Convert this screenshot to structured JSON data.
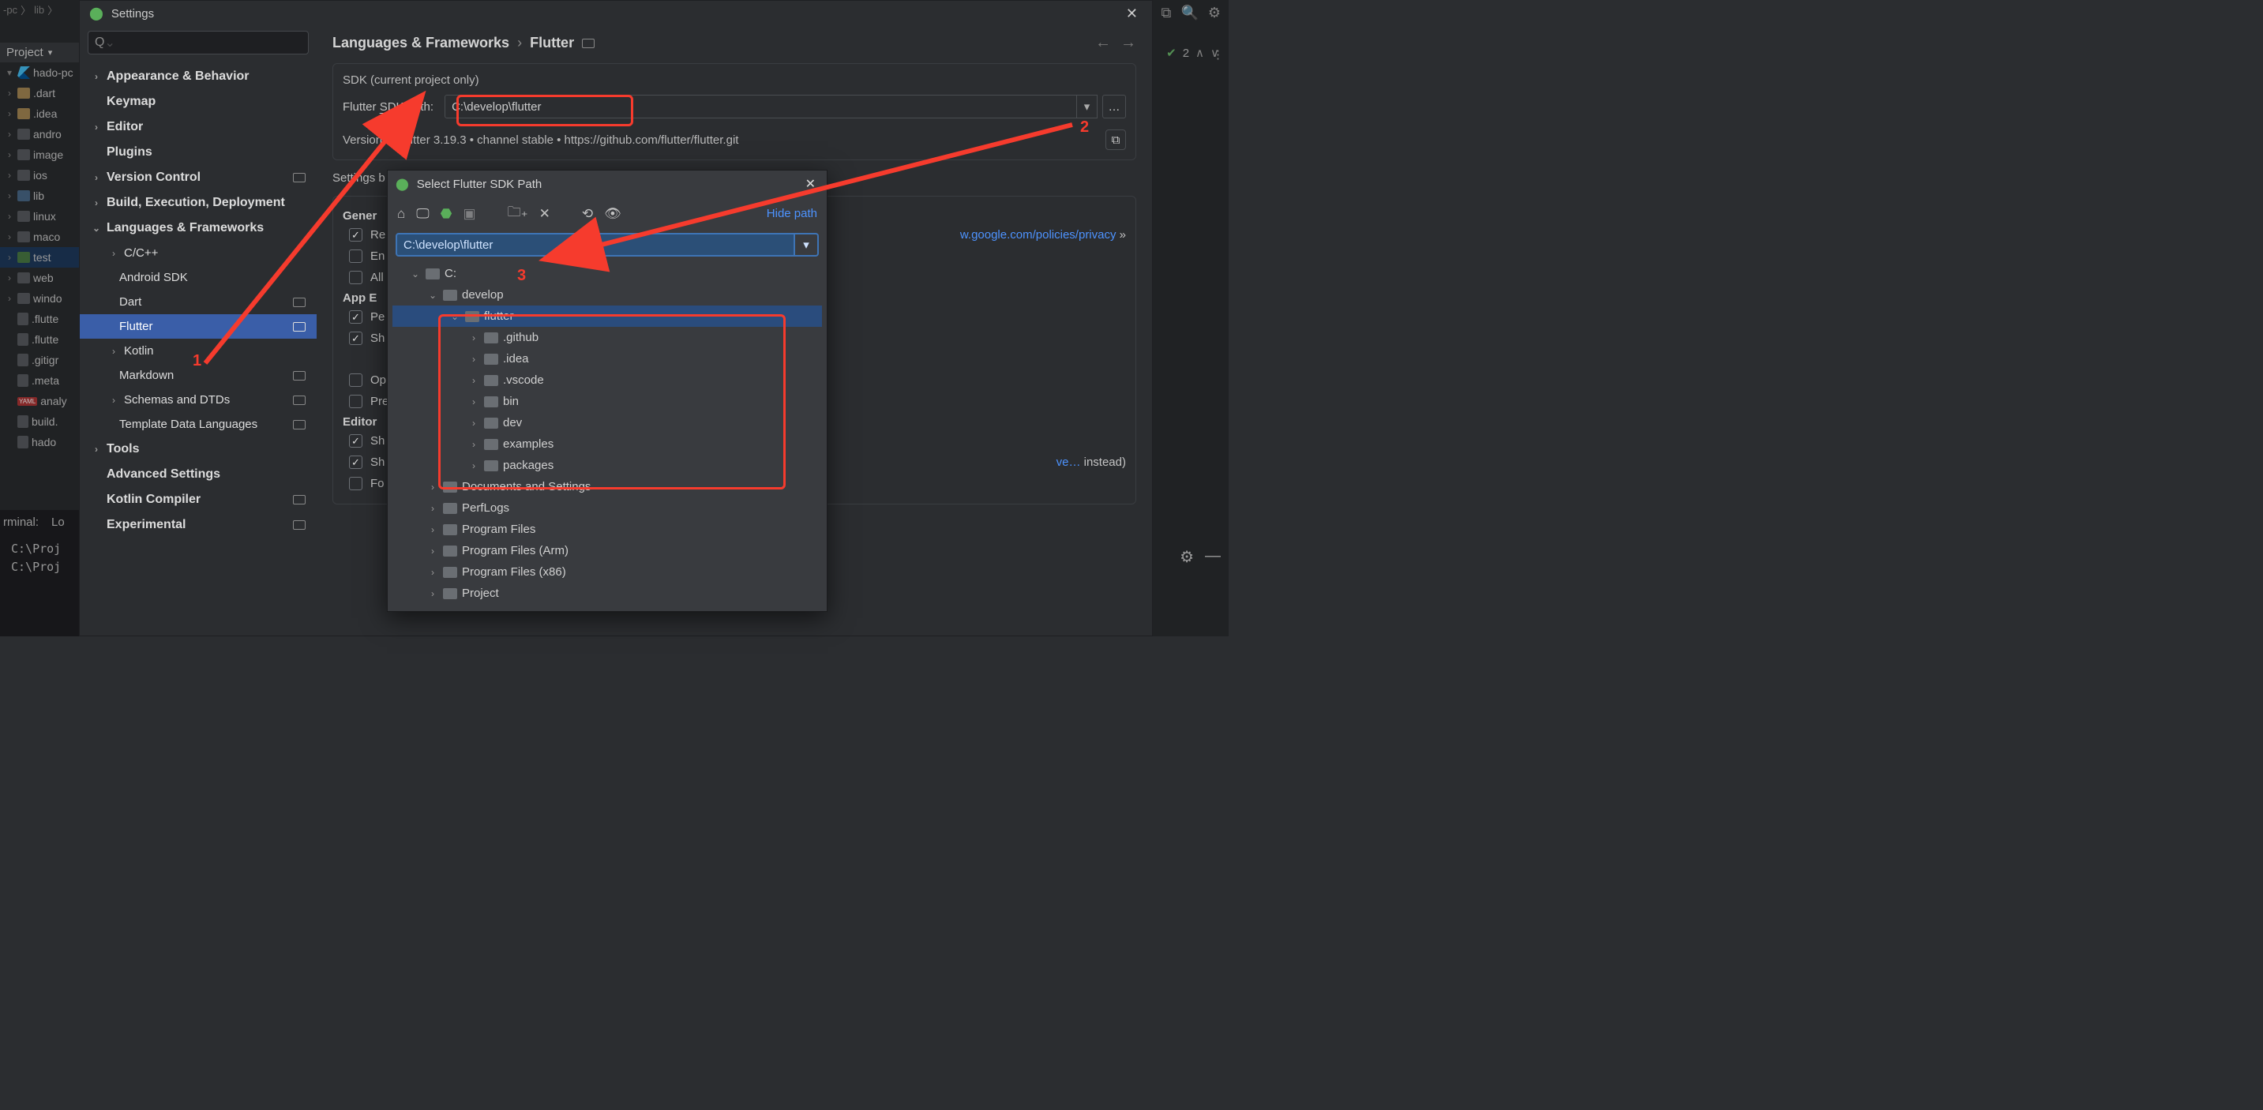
{
  "breadcrumb": {
    "a": "-pc",
    "b": "lib"
  },
  "project_header": "Project",
  "project_root": "hado-pc",
  "project_tree": [
    ".dart",
    ".idea",
    "andro",
    "image",
    "ios",
    "lib",
    "linux",
    "maco",
    "test",
    "web",
    "windo",
    ".flutte",
    ".flutte",
    ".gitigr",
    ".meta",
    "analy",
    "build.",
    "hado"
  ],
  "terminal_tab_a": "rminal:",
  "terminal_tab_b": "Lo",
  "terminal_lines": [
    "C:\\Proj",
    "C:\\Proj"
  ],
  "right": {
    "problems_count": "2"
  },
  "dialog": {
    "title": "Settings",
    "search_placeholder": "Q",
    "nav": {
      "appearance": "Appearance & Behavior",
      "keymap": "Keymap",
      "editor": "Editor",
      "plugins": "Plugins",
      "vcs": "Version Control",
      "bed": "Build, Execution, Deployment",
      "lang": "Languages & Frameworks",
      "cc": "C/C++",
      "android_sdk": "Android SDK",
      "dart": "Dart",
      "flutter": "Flutter",
      "kotlin": "Kotlin",
      "markdown": "Markdown",
      "schemas": "Schemas and DTDs",
      "template": "Template Data Languages",
      "tools": "Tools",
      "adv": "Advanced Settings",
      "kcomp": "Kotlin Compiler",
      "exp": "Experimental"
    },
    "crumb1": "Languages & Frameworks",
    "crumb2": "Flutter",
    "sdk_group": "SDK (current project only)",
    "sdk_label": "Flutter SDK path:",
    "sdk_value": "C:\\develop\\flutter",
    "version_label": "Version:",
    "version_value": "Flutter 3.19.3 • channel stable • https://github.com/flutter/flutter.git",
    "settings_block_prefix": "Settings b",
    "general": "Gener",
    "chk_re": "Re",
    "chk_en": "En",
    "chk_all": "All",
    "app_exec": "App E",
    "chk_pe": "Pe",
    "chk_sh1": "Sh",
    "chk_op": "Op",
    "chk_pre": "Pre",
    "editor_sect": "Editor",
    "chk_sh2": "Sh",
    "chk_sh3": "Sh",
    "chk_fo": "Fo",
    "policy_link": "w.google.com/policies/privacy",
    "policy_suffix": " »",
    "save_hint_a": "ve…",
    "save_hint_b": "   instead)"
  },
  "path_dialog": {
    "title": "Select Flutter SDK Path",
    "hide": "Hide path",
    "path_value": "C:\\develop\\flutter",
    "tree": {
      "c": "C:",
      "develop": "develop",
      "flutter": "flutter",
      "github": ".github",
      "idea": ".idea",
      "vscode": ".vscode",
      "bin": "bin",
      "dev": "dev",
      "examples": "examples",
      "packages": "packages",
      "docs": "Documents and Settings",
      "perflogs": "PerfLogs",
      "pf": "Program Files",
      "pfa": "Program Files (Arm)",
      "pfx": "Program Files (x86)",
      "project": "Project"
    }
  },
  "annotations": {
    "n1": "1",
    "n2": "2",
    "n3": "3"
  }
}
